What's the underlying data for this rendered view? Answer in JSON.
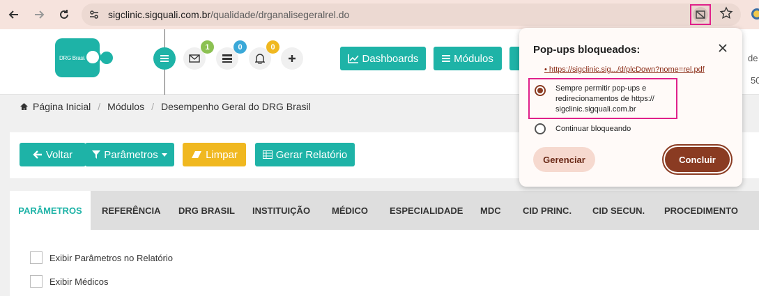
{
  "browser": {
    "url_host": "sigclinic.sigquali.com.br",
    "url_path": "/qualidade/drganalisegeralrel.do"
  },
  "header": {
    "logo_text": "DRG Brasil",
    "badges": {
      "messages": "1",
      "tasks": "0",
      "notifications": "0"
    },
    "dashboards_label": "Dashboards",
    "modulos_label": "Módulos",
    "right_fragment_1": "de",
    "right_fragment_2": "50"
  },
  "breadcrumb": {
    "home": "Página Inicial",
    "modulos": "Módulos",
    "current": "Desempenho Geral do DRG Brasil"
  },
  "actions": {
    "voltar": "Voltar",
    "parametros": "Parâmetros",
    "limpar": "Limpar",
    "gerar": "Gerar Relatório"
  },
  "tabs": [
    "PARÂMETROS",
    "REFERÊNCIA",
    "DRG BRASIL",
    "INSTITUIÇÃO",
    "MÉDICO",
    "ESPECIALIDADE",
    "MDC",
    "CID PRINC.",
    "CID SECUN.",
    "PROCEDIMENTO"
  ],
  "options": {
    "exibir_parametros": "Exibir Parâmetros no Relatório",
    "exibir_medicos": "Exibir Médicos"
  },
  "popup": {
    "title": "Pop-ups bloqueados:",
    "blocked_link": "https://sigclinic.sig.../d/plcDown?nome=rel.pdf",
    "option_allow_l1": "Sempre permitir pop-ups e",
    "option_allow_l2": "redirecionamentos de https://",
    "option_allow_l3": "sigclinic.sigquali.com.br",
    "option_block": "Continuar bloqueando",
    "manage": "Gerenciar",
    "done": "Concluir"
  },
  "colors": {
    "teal": "#1eb3a7",
    "yellow": "#f0b820",
    "chrome_bg": "#f6e3dd",
    "popup_accent": "#8a3b22",
    "highlight": "#e0218a"
  }
}
